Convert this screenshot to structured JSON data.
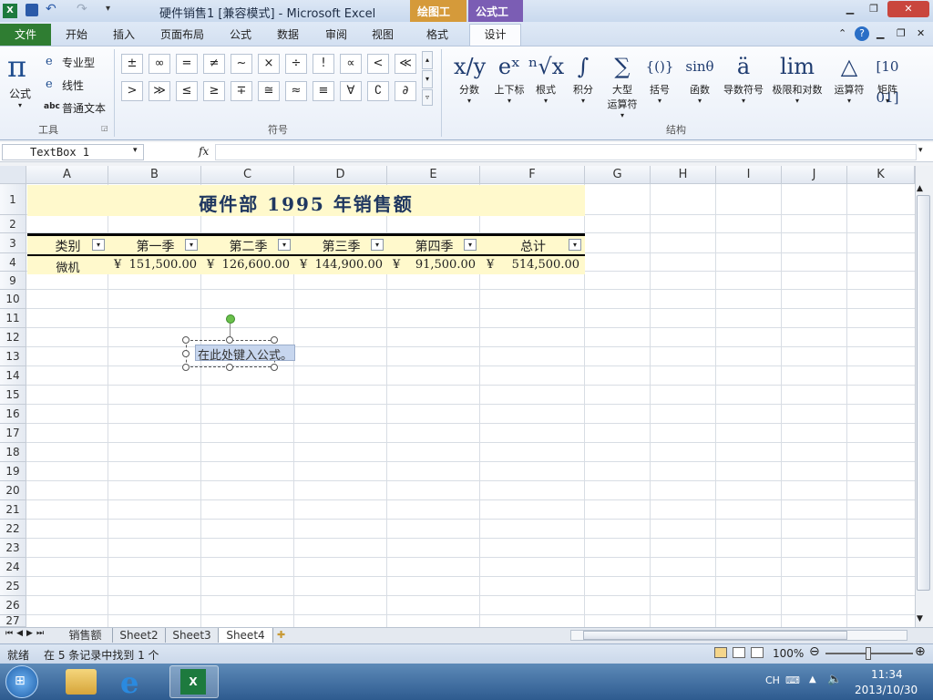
{
  "window": {
    "title": "硬件销售1  [兼容模式] - Microsoft Excel",
    "ctx_drawing": "绘图工具",
    "ctx_formula": "公式工具"
  },
  "tabs": {
    "file": "文件",
    "home": "开始",
    "insert": "插入",
    "layout": "页面布局",
    "formulas": "公式",
    "data": "数据",
    "review": "审阅",
    "view": "视图",
    "format": "格式",
    "design": "设计"
  },
  "tools": {
    "formula": "公式",
    "pro": "专业型",
    "linear": "线性",
    "normal": "普通文本",
    "group": "工具",
    "abc": "abc"
  },
  "symbols": {
    "row1": [
      "±",
      "∞",
      "=",
      "≠",
      "~",
      "×",
      "÷",
      "!",
      "∝",
      "<",
      "≪"
    ],
    "row2": [
      ">",
      "≫",
      "≤",
      "≥",
      "∓",
      "≅",
      "≈",
      "≡",
      "∀",
      "∁",
      "∂"
    ],
    "group": "符号"
  },
  "structures": {
    "items": [
      {
        "glyph": "x/y",
        "label": "分数"
      },
      {
        "glyph": "eˣ",
        "label": "上下标"
      },
      {
        "glyph": "ⁿ√x",
        "label": "根式"
      },
      {
        "glyph": "∫",
        "label": "积分"
      },
      {
        "glyph": "∑",
        "label": "大型\n运算符"
      },
      {
        "glyph": "{()}",
        "label": "括号"
      },
      {
        "glyph": "sinθ",
        "label": "函数"
      },
      {
        "glyph": "ä",
        "label": "导数符号"
      },
      {
        "glyph": "lim",
        "label": "极限和对数"
      },
      {
        "glyph": "△",
        "label": "运算符"
      },
      {
        "glyph": "[10\n01]",
        "label": "矩阵"
      }
    ],
    "group": "结构"
  },
  "formulabar": {
    "namebox": "TextBox 1",
    "fx": "fx"
  },
  "columns": [
    "A",
    "B",
    "C",
    "D",
    "E",
    "F",
    "G",
    "H",
    "I",
    "J",
    "K"
  ],
  "rows": [
    "1",
    "2",
    "3",
    "4",
    "9",
    "10",
    "11",
    "12",
    "13",
    "14",
    "15",
    "16",
    "17",
    "18",
    "19",
    "20",
    "21",
    "22",
    "23",
    "24",
    "25",
    "26",
    "27"
  ],
  "sheet": {
    "title": "硬件部  1995  年销售额",
    "headers": [
      "类别",
      "第一季",
      "第二季",
      "第三季",
      "第四季",
      "总计"
    ],
    "row4": {
      "category": "微机",
      "currency": "¥",
      "q1": "151,500.00",
      "q2": "126,600.00",
      "q3": "144,900.00",
      "q4": "91,500.00",
      "total": "514,500.00"
    }
  },
  "textbox": {
    "placeholder": "在此处键入公式。"
  },
  "sheettabs": [
    "销售额",
    "Sheet2",
    "Sheet3",
    "Sheet4"
  ],
  "status": {
    "ready": "就绪",
    "filter_msg": "在 5 条记录中找到 1 个",
    "zoom": "100%"
  },
  "taskbar": {
    "lang": "CH",
    "time": "11:34",
    "date": "2013/10/30"
  },
  "colors": {
    "file_tab": "#2f7d32",
    "ctx_drawing": "#d59a3a",
    "ctx_formula": "#7b5db4",
    "title_fill": "#fff9cc"
  }
}
